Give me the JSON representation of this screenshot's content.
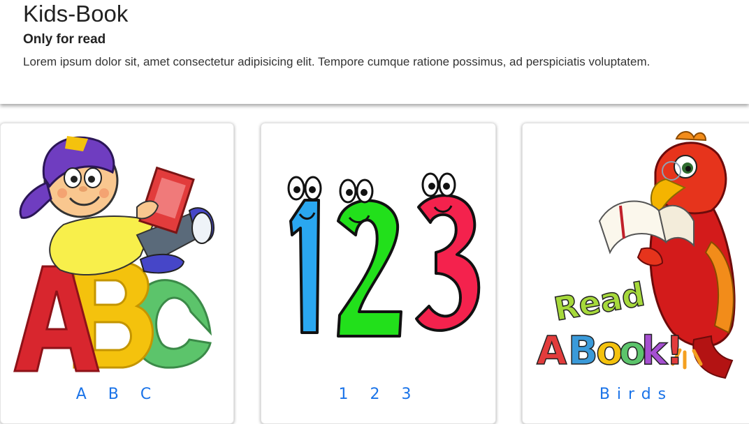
{
  "header": {
    "title": "Kids-Book",
    "subtitle": "Only for read",
    "description": "Lorem ipsum dolor sit, amet consectetur adipisicing elit. Tempore cumque ratione possimus, ad perspiciatis voluptatem."
  },
  "cards": [
    {
      "label": "A B C",
      "icon": "abc-boy-reading-illustration"
    },
    {
      "label": "1 2 3",
      "icon": "numbers-123-illustration"
    },
    {
      "label": "Birds",
      "icon": "parrot-read-a-book-illustration"
    }
  ],
  "colors": {
    "label_blue": "#1a73e8",
    "letter_red": "#d8262e",
    "letter_yellow": "#f4c20d",
    "letter_green": "#5cc46b",
    "number_blue": "#2aa7f0",
    "number_green": "#22e01b",
    "number_red": "#f4224d",
    "parrot_red": "#d31b1b"
  }
}
